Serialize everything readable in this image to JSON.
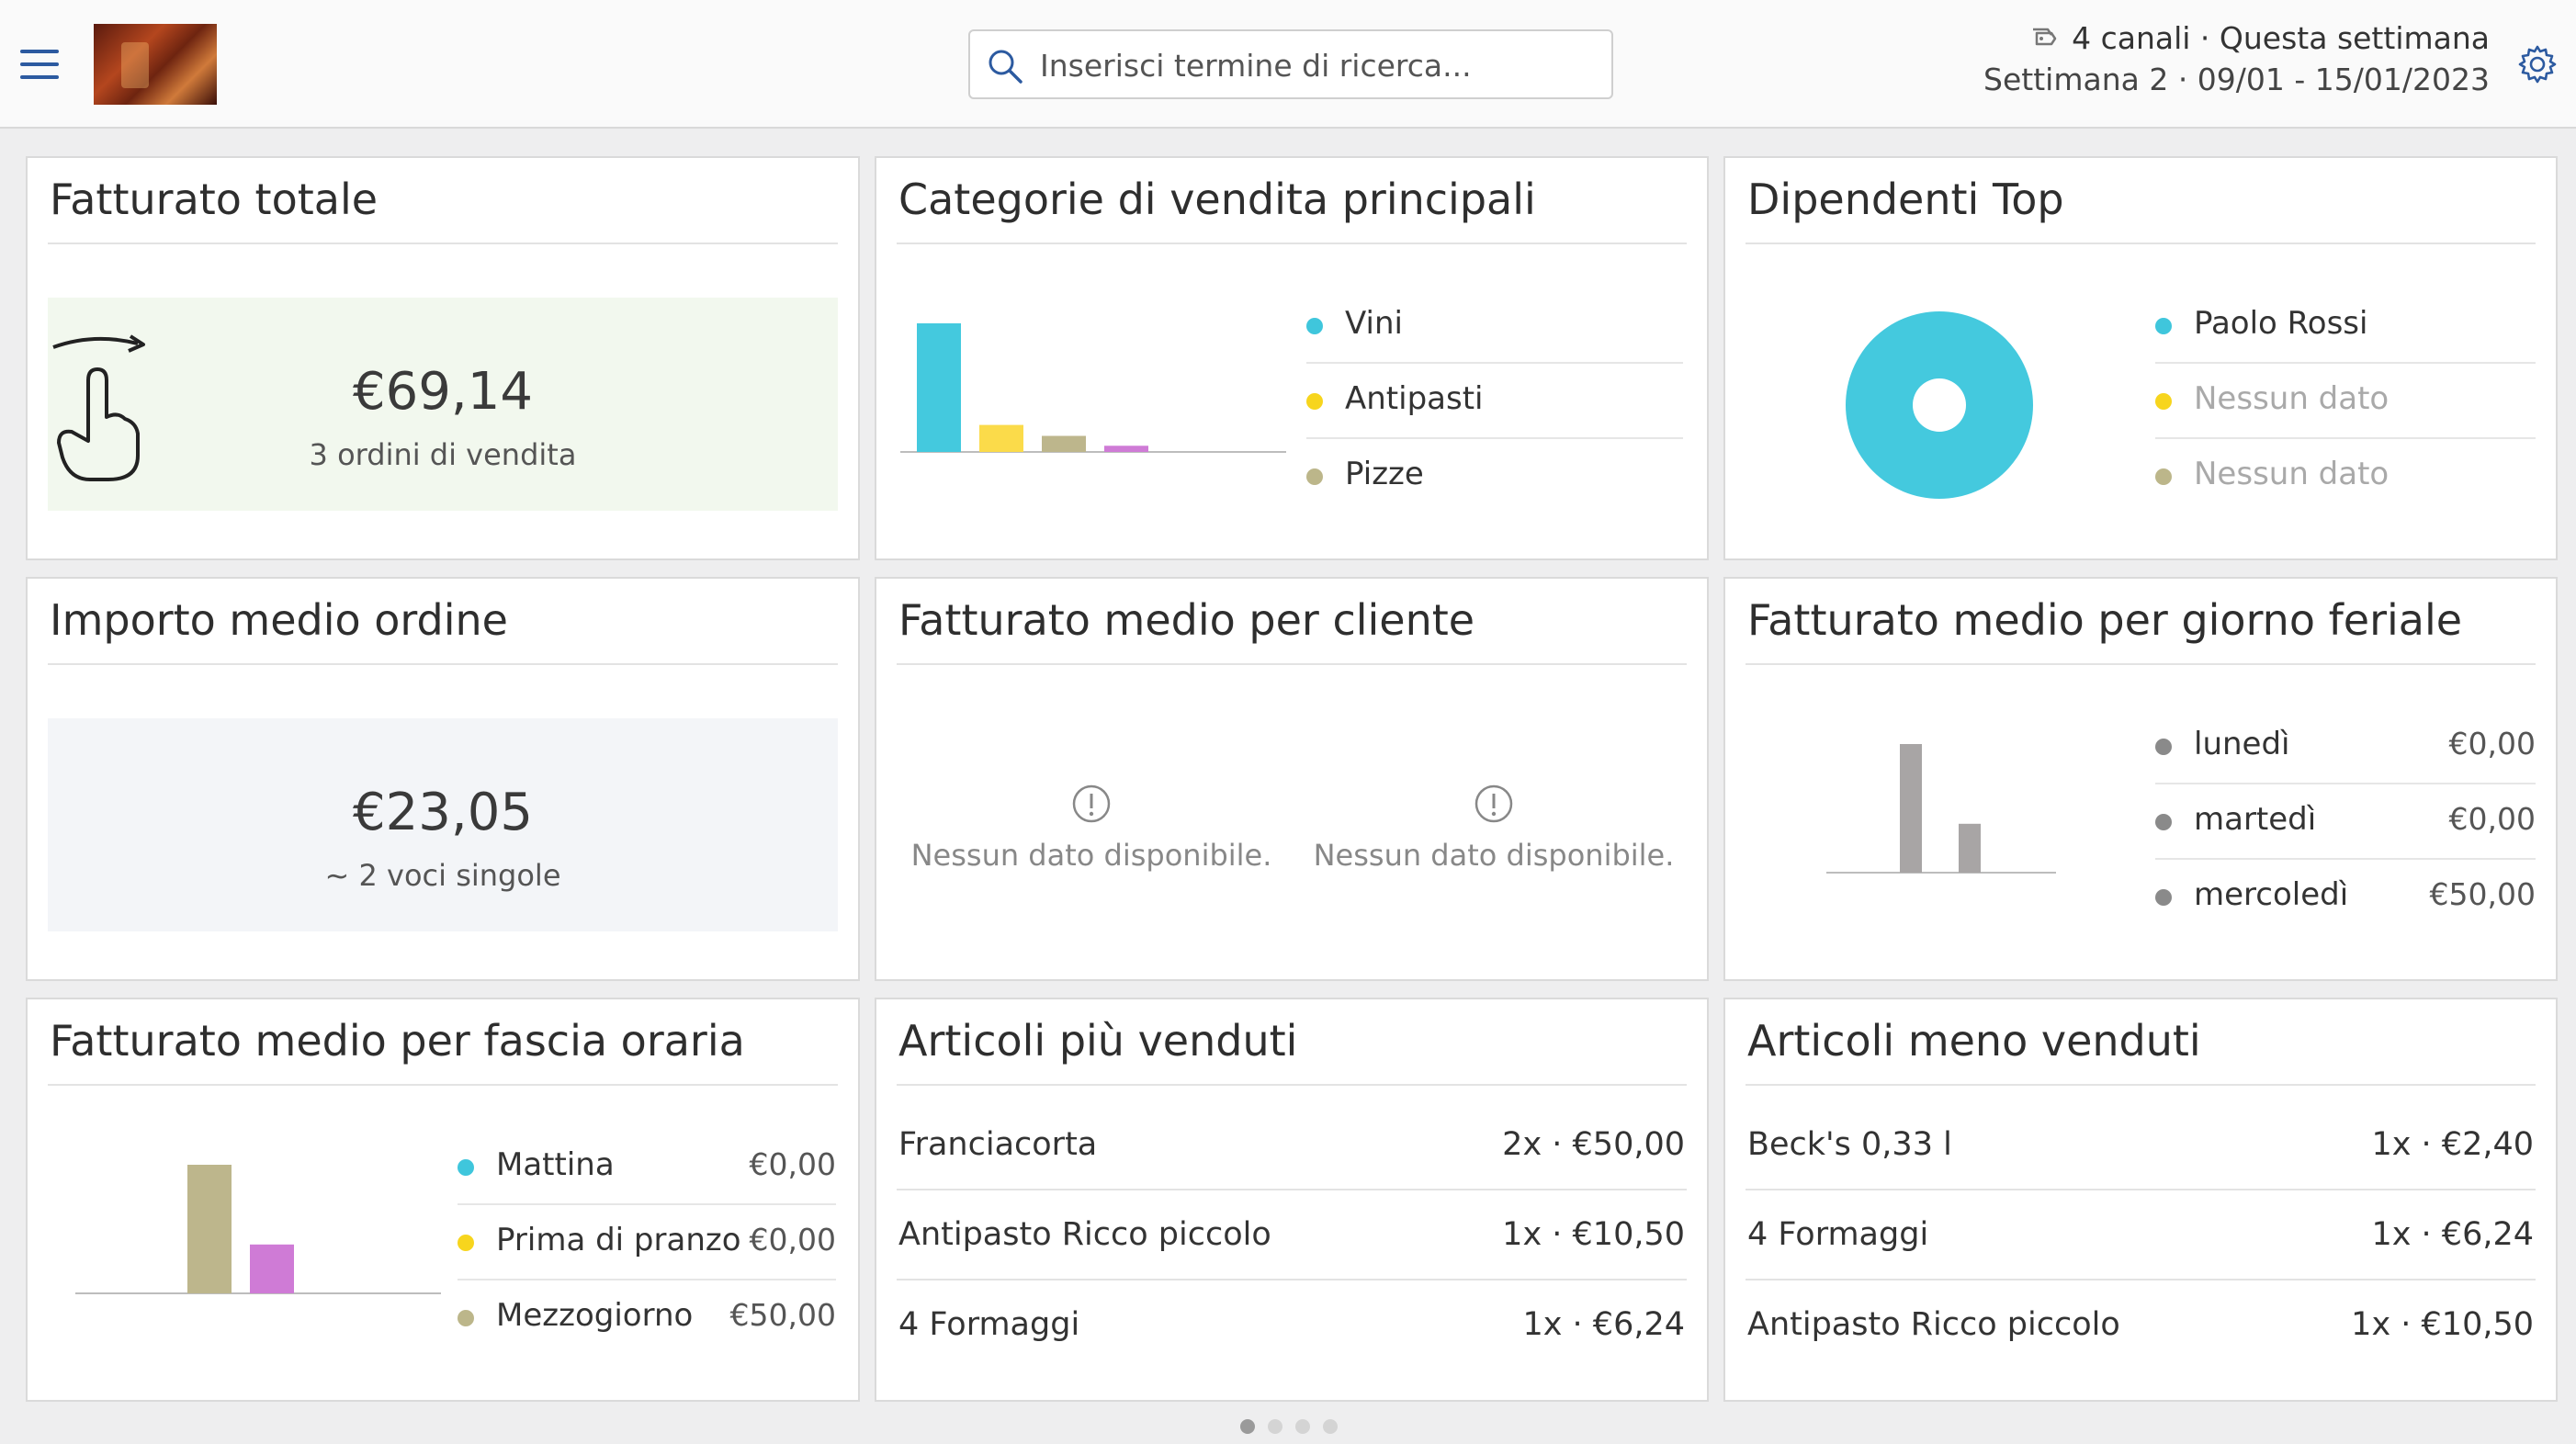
{
  "header": {
    "search_placeholder": "Inserisci termine di ricerca...",
    "channels_label": "4 canali · Questa settimana",
    "week_label": "Settimana 2 · 09/01 - 15/01/2023"
  },
  "cards": {
    "total_revenue": {
      "title": "Fatturato totale",
      "value": "€69,14",
      "subtitle": "3 ordini di vendita"
    },
    "top_categories": {
      "title": "Categorie di vendita principali",
      "legend": [
        {
          "label": "Vini",
          "color": "#3fc6dc"
        },
        {
          "label": "Antipasti",
          "color": "#f7d51d"
        },
        {
          "label": "Pizze",
          "color": "#bcb68a"
        }
      ]
    },
    "top_employees": {
      "title": "Dipendenti Top",
      "legend": [
        {
          "label": "Paolo Rossi",
          "color": "#3fc6dc"
        },
        {
          "label": "Nessun dato",
          "color": "#f7d51d"
        },
        {
          "label": "Nessun dato",
          "color": "#bcb68a"
        }
      ]
    },
    "avg_order": {
      "title": "Importo medio ordine",
      "value": "€23,05",
      "subtitle": "~ 2 voci singole"
    },
    "avg_customer": {
      "title": "Fatturato medio per cliente",
      "empty_left": "Nessun dato disponibile.",
      "empty_right": "Nessun dato disponibile."
    },
    "avg_weekday": {
      "title": "Fatturato medio per giorno feriale",
      "legend": [
        {
          "label": "lunedì",
          "value": "€0,00"
        },
        {
          "label": "martedì",
          "value": "€0,00"
        },
        {
          "label": "mercoledì",
          "value": "€50,00"
        }
      ]
    },
    "avg_timeslot": {
      "title": "Fatturato medio per fascia oraria",
      "legend": [
        {
          "label": "Mattina",
          "value": "€0,00",
          "color": "#3fc6dc"
        },
        {
          "label": "Prima di pranzo",
          "value": "€0,00",
          "color": "#f7d51d"
        },
        {
          "label": "Mezzogiorno",
          "value": "€50,00",
          "color": "#bcb68a"
        }
      ]
    },
    "best_sellers": {
      "title": "Articoli più venduti",
      "items": [
        {
          "name": "Franciacorta",
          "qty": "2x · €50,00"
        },
        {
          "name": "Antipasto Ricco piccolo",
          "qty": "1x · €10,50"
        },
        {
          "name": "4 Formaggi",
          "qty": "1x · €6,24"
        }
      ]
    },
    "worst_sellers": {
      "title": "Articoli meno venduti",
      "items": [
        {
          "name": "Beck's 0,33 l",
          "qty": "1x · €2,40"
        },
        {
          "name": "4 Formaggi",
          "qty": "1x · €6,24"
        },
        {
          "name": "Antipasto Ricco piccolo",
          "qty": "1x · €10,50"
        }
      ]
    }
  },
  "chart_data": [
    {
      "type": "bar",
      "categories": [
        "Vini",
        "Antipasti",
        "Pizze",
        ""
      ],
      "values": [
        50,
        10.5,
        6.24,
        2.4
      ],
      "colors": [
        "#44c9de",
        "#fbdb4a",
        "#bdb68c",
        "#cf7bd6"
      ],
      "ylim": [
        0,
        50
      ],
      "grid": false
    },
    {
      "type": "pie",
      "categories": [
        "Paolo Rossi"
      ],
      "values": [
        100
      ],
      "colors": [
        "#44c9de"
      ],
      "grid": false
    },
    {
      "type": "bar",
      "categories": [
        "",
        ""
      ],
      "values": [
        50,
        19
      ],
      "colors": [
        "#a8a5a5",
        "#a8a5a5"
      ],
      "ylim": [
        0,
        50
      ],
      "grid": false
    },
    {
      "type": "bar",
      "categories": [
        "",
        ""
      ],
      "values": [
        50,
        19
      ],
      "colors": [
        "#bdb68c",
        "#cf7bd6"
      ],
      "ylim": [
        0,
        50
      ],
      "grid": false
    }
  ],
  "pager": {
    "pages": 4,
    "active": 0
  }
}
